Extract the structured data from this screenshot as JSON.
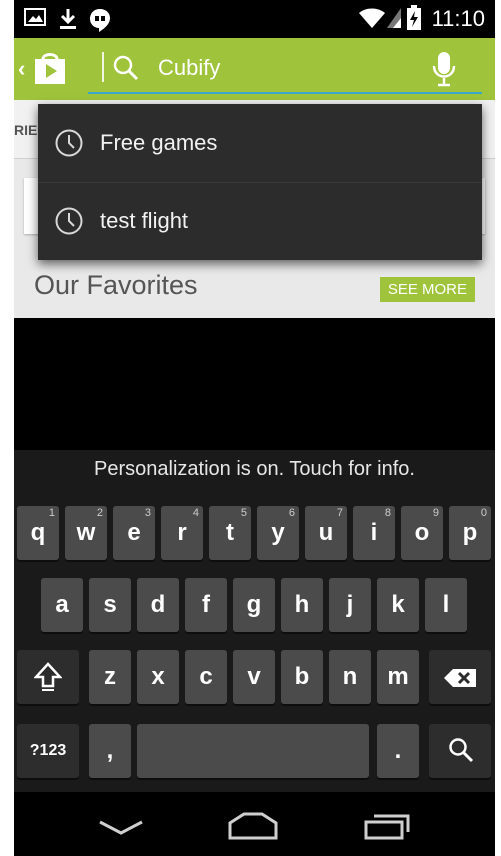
{
  "status_bar": {
    "time": "11:10",
    "left_icons": [
      "image-icon",
      "download-icon",
      "hangouts-icon"
    ],
    "right_icons": [
      "wifi-icon",
      "signal-icon",
      "battery-icon"
    ]
  },
  "action_bar": {
    "app_icon": "play-store-icon",
    "search": {
      "query": "Cubify",
      "icon": "search-icon",
      "voice_icon": "mic-icon"
    }
  },
  "background_page": {
    "tab_partial": "RIE",
    "section_title": "Our Favorites",
    "see_more": "SEE MORE"
  },
  "suggestions": [
    {
      "text": "Free games",
      "icon": "history-clock-icon"
    },
    {
      "text": "test flight",
      "icon": "history-clock-icon"
    }
  ],
  "keyboard": {
    "banner": "Personalization is on. Touch for info.",
    "row1": [
      {
        "label": "q",
        "num": "1"
      },
      {
        "label": "w",
        "num": "2"
      },
      {
        "label": "e",
        "num": "3"
      },
      {
        "label": "r",
        "num": "4"
      },
      {
        "label": "t",
        "num": "5"
      },
      {
        "label": "y",
        "num": "6"
      },
      {
        "label": "u",
        "num": "7"
      },
      {
        "label": "i",
        "num": "8"
      },
      {
        "label": "o",
        "num": "9"
      },
      {
        "label": "p",
        "num": "0"
      }
    ],
    "row2": [
      "a",
      "s",
      "d",
      "f",
      "g",
      "h",
      "j",
      "k",
      "l"
    ],
    "row3": [
      "z",
      "x",
      "c",
      "v",
      "b",
      "n",
      "m"
    ],
    "row4": {
      "symbols": "?123",
      "comma": ",",
      "period": "."
    },
    "icons": {
      "shift": "shift-icon",
      "delete": "backspace-icon",
      "search": "search-icon",
      "space": "space-bar"
    }
  },
  "navigation": [
    "back-icon",
    "home-icon",
    "recents-icon"
  ],
  "colors": {
    "accent": "#9fc33b",
    "underline": "#3aa9c9",
    "dropdown_bg": "#2c2c2c",
    "key_bg": "#4b4b4b"
  }
}
